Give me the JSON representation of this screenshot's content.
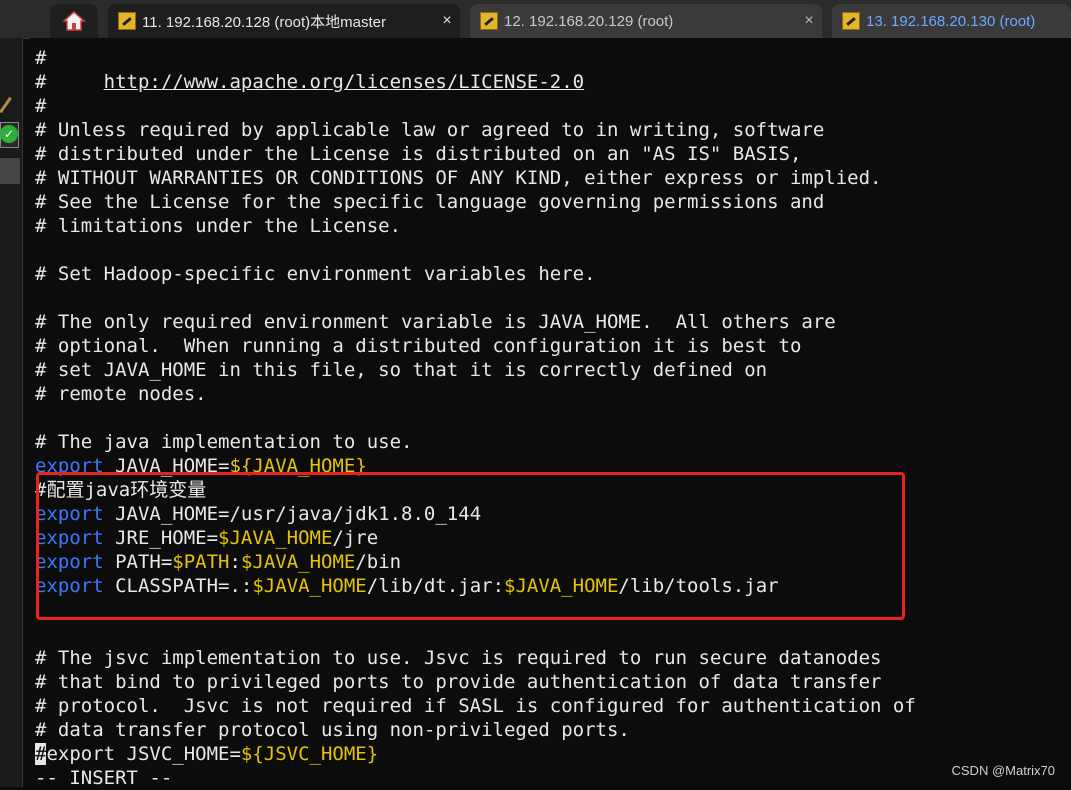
{
  "tabs": [
    {
      "label": "11. 192.168.20.128 (root)本地master",
      "close": "×",
      "active": true
    },
    {
      "label": "12. 192.168.20.129 (root)",
      "close": "×",
      "active": false
    },
    {
      "label": "13. 192.168.20.130 (root)",
      "active": false
    }
  ],
  "terminal": {
    "lines": [
      "#",
      "#     ",
      "http://www.apache.org/licenses/LICENSE-2.0",
      "#",
      "# Unless required by applicable law or agreed to in writing, software",
      "# distributed under the License is distributed on an \"AS IS\" BASIS,",
      "# WITHOUT WARRANTIES OR CONDITIONS OF ANY KIND, either express or implied.",
      "# See the License for the specific language governing permissions and",
      "# limitations under the License.",
      "# Set Hadoop-specific environment variables here.",
      "# The only required environment variable is JAVA_HOME.  All others are",
      "# optional.  When running a distributed configuration it is best to",
      "# set JAVA_HOME in this file, so that it is correctly defined on",
      "# remote nodes.",
      "# The java implementation to use.",
      "export",
      " JAVA_HOME=",
      "${JAVA_HOME}",
      "#配置java环境变量",
      "export",
      " JAVA_HOME=/usr/java/jdk1.8.0_144",
      "export",
      " JRE_HOME=",
      "$JAVA_HOME",
      "/jre",
      "export",
      " PATH=",
      "$PATH",
      ":",
      "$JAVA_HOME",
      "/bin",
      "export",
      " CLASSPATH=.:",
      "$JAVA_HOME",
      "/lib/dt.jar:",
      "$JAVA_HOME",
      "/lib/tools.jar",
      "# The jsvc implementation to use. Jsvc is required to run secure datanodes",
      "# that bind to privileged ports to provide authentication of data transfer",
      "# protocol.  Jsvc is not required if SASL is configured for authentication of",
      "# data transfer protocol using non-privileged ports.",
      "#",
      "export JSVC_HOME=",
      "${JSVC_HOME}",
      "-- INSERT --"
    ]
  },
  "watermark": "CSDN @Matrix70",
  "colors": {
    "keyword": "#3b78ff",
    "variable": "#e5c400",
    "highlight_box": "#e8231e"
  },
  "icons": [
    "home-icon",
    "terminal-tab-icon",
    "check-icon"
  ]
}
